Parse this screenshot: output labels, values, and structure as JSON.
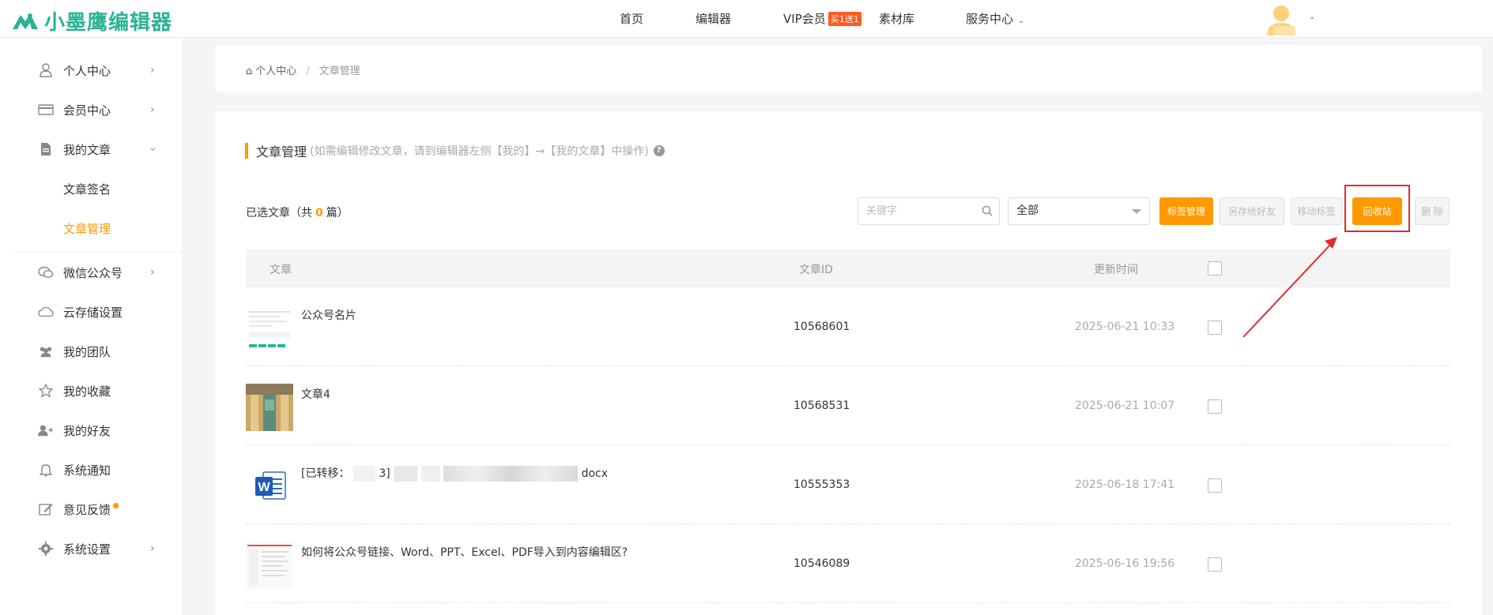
{
  "brand": {
    "name": "小墨鹰编辑器"
  },
  "nav": {
    "home": "首页",
    "editor": "编辑器",
    "vip": "VIP会员",
    "vip_badge": "买1送1",
    "materials": "素材库",
    "service": "服务中心"
  },
  "sidebar": {
    "items": [
      {
        "label": "个人中心",
        "icon": "user-icon"
      },
      {
        "label": "会员中心",
        "icon": "card-icon"
      },
      {
        "label": "我的文章",
        "icon": "document-icon"
      },
      {
        "label": "文章签名",
        "icon": ""
      },
      {
        "label": "文章管理",
        "icon": ""
      },
      {
        "label": "微信公众号",
        "icon": "wechat-icon"
      },
      {
        "label": "云存储设置",
        "icon": "cloud-icon"
      },
      {
        "label": "我的团队",
        "icon": "team-icon"
      },
      {
        "label": "我的收藏",
        "icon": "star-icon"
      },
      {
        "label": "我的好友",
        "icon": "add-friend-icon"
      },
      {
        "label": "系统通知",
        "icon": "bell-icon"
      },
      {
        "label": "意见反馈",
        "icon": "edit-icon"
      },
      {
        "label": "系统设置",
        "icon": "gear-icon"
      }
    ]
  },
  "breadcrumb": {
    "parent": "个人中心",
    "separator": "/",
    "current": "文章管理"
  },
  "section": {
    "title": "文章管理",
    "hint": "(如需编辑修改文章，请到编辑器左侧【我的】→【我的文章】中操作)"
  },
  "toolbar": {
    "selected_prefix": "已选文章（共",
    "selected_count": "0",
    "selected_suffix": "篇）",
    "search_placeholder": "关键字",
    "filter_value": "全部",
    "tag_manage": "标签管理",
    "save_as_friend": "另存给好友",
    "move_tag": "移动标签",
    "recycle_bin": "回收站",
    "delete": "删 除"
  },
  "table": {
    "headers": {
      "article": "文章",
      "id": "文章ID",
      "updated": "更新时间"
    },
    "rows": [
      {
        "title": "公众号名片",
        "id": "10568601",
        "time": "2025-06-21 10:33"
      },
      {
        "title": "文章4",
        "id": "10568531",
        "time": "2025-06-21 10:07"
      },
      {
        "title_prefix": "[已转移：",
        "title_mid": "3]",
        "title_suffix": "docx",
        "id": "10555353",
        "time": "2025-06-18 17:41"
      },
      {
        "title": "如何将公众号链接、Word、PPT、Excel、PDF导入到内容编辑区?",
        "id": "10546089",
        "time": "2025-06-16 19:56"
      }
    ]
  },
  "colors": {
    "accent": "#ff9900",
    "brand": "#2bb394",
    "highlight": "#e02b2b"
  }
}
